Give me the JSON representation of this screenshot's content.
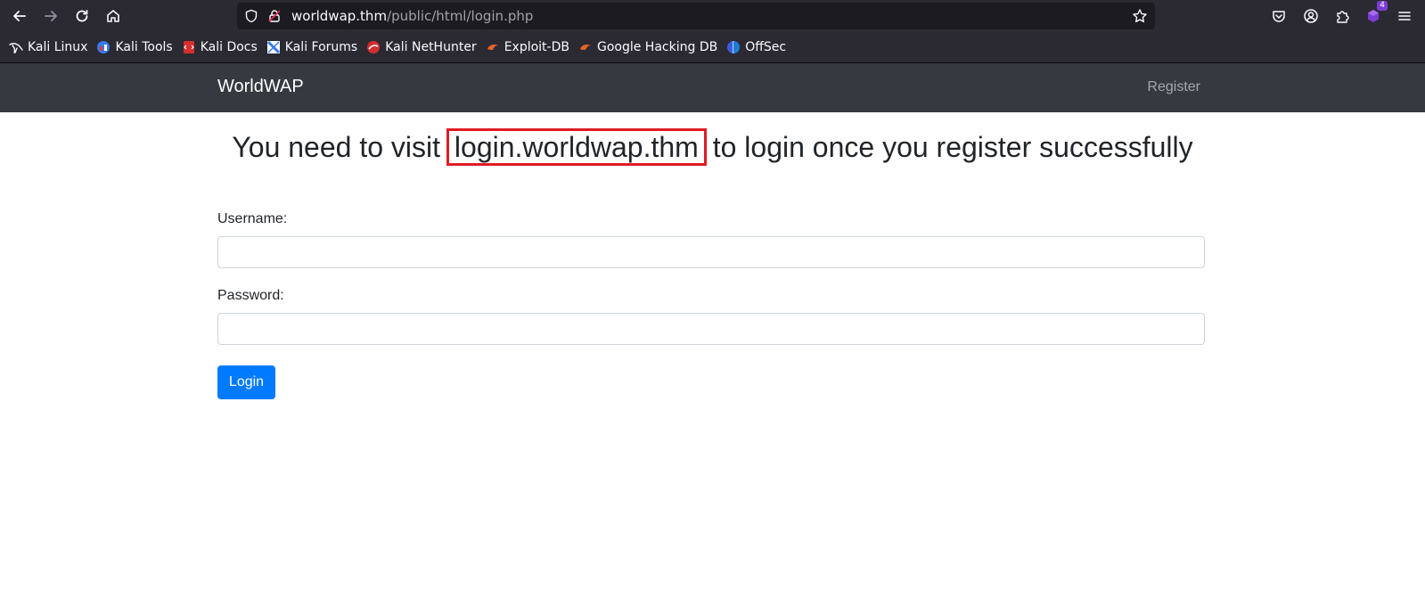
{
  "browser": {
    "url_host": "worldwap.thm",
    "url_path": "/public/html/login.php",
    "extension_badge": "4",
    "bookmarks": [
      {
        "label": "Kali Linux",
        "icon": "kali-dragon-icon"
      },
      {
        "label": "Kali Tools",
        "icon": "kali-tools-icon"
      },
      {
        "label": "Kali Docs",
        "icon": "kali-docs-icon"
      },
      {
        "label": "Kali Forums",
        "icon": "kali-forums-icon"
      },
      {
        "label": "Kali NetHunter",
        "icon": "kali-nethunter-icon"
      },
      {
        "label": "Exploit-DB",
        "icon": "exploit-db-icon"
      },
      {
        "label": "Google Hacking DB",
        "icon": "ghdb-icon"
      },
      {
        "label": "OffSec",
        "icon": "offsec-icon"
      }
    ]
  },
  "site": {
    "brand": "WorldWAP",
    "nav_register": "Register"
  },
  "page": {
    "heading_before": "You need to visit ",
    "heading_highlight": "login.worldwap.thm",
    "heading_after": " to login once you register successfully",
    "username_label": "Username:",
    "username_value": "",
    "password_label": "Password:",
    "password_value": "",
    "login_button": "Login"
  },
  "colors": {
    "navbar_bg": "#343a40",
    "primary": "#007bff",
    "highlight_border": "#e01b24",
    "browser_bg": "#2b2a33"
  }
}
